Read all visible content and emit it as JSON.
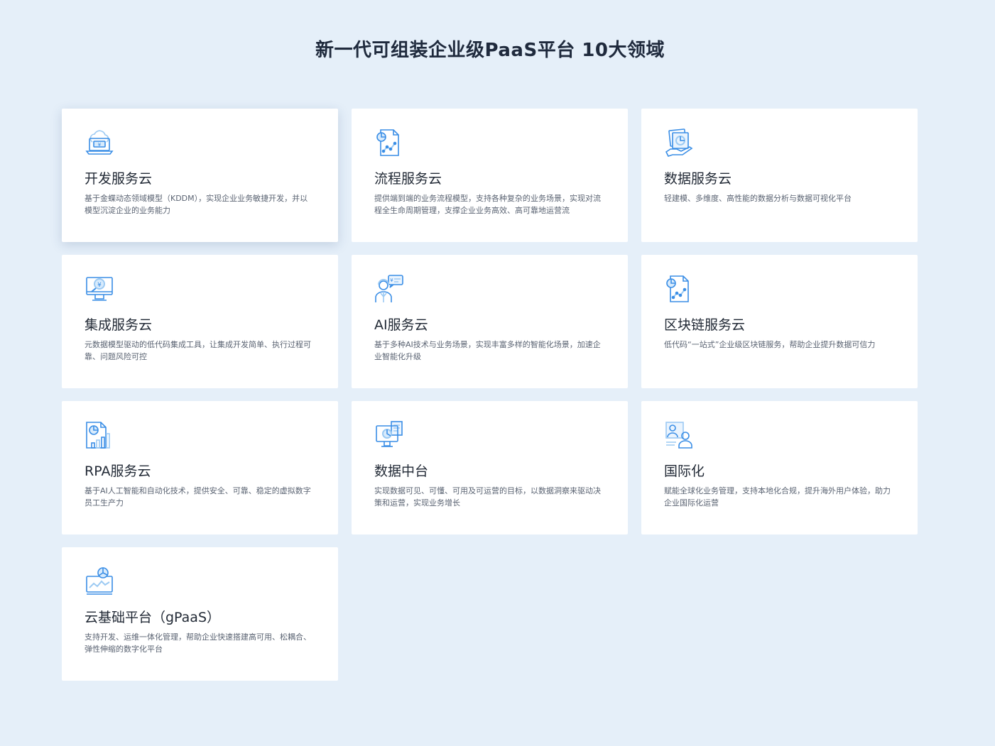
{
  "page": {
    "title": "新一代可组装企业级PaaS平台 10大领域"
  },
  "cards": [
    {
      "icon": "cloud-laptop-icon",
      "title": "开发服务云",
      "desc": "基于金蝶动态领域模型（KDDM），实现企业业务敏捷开发，并以模型沉淀企业的业务能力"
    },
    {
      "icon": "process-document-icon",
      "title": "流程服务云",
      "desc": "提供端到端的业务流程模型，支持各种复杂的业务场景，实现对流程全生命周期管理，支撑企业业务高效、高可靠地运营流"
    },
    {
      "icon": "data-hand-icon",
      "title": "数据服务云",
      "desc": "轻建模、多维度、高性能的数据分析与数据可视化平台"
    },
    {
      "icon": "monitor-yen-icon",
      "title": "集成服务云",
      "desc": "元数据模型驱动的低代码集成工具，让集成开发简单、执行过程可靠、问题风险可控"
    },
    {
      "icon": "ai-person-icon",
      "title": "AI服务云",
      "desc": "基于多种AI技术与业务场景，实现丰富多样的智能化场景，加速企业智能化升级"
    },
    {
      "icon": "chain-document-icon",
      "title": "区块链服务云",
      "desc": "低代码“一站式”企业级区块链服务，帮助企业提升数据可信力"
    },
    {
      "icon": "bar-chart-document-icon",
      "title": "RPA服务云",
      "desc": "基于AI人工智能和自动化技术，提供安全、可靠、稳定的虚拟数字员工生产力"
    },
    {
      "icon": "dashboard-monitor-icon",
      "title": "数据中台",
      "desc": "实现数据可见、可懂、可用及可运营的目标，以数据洞察来驱动决策和运营，实现业务增长"
    },
    {
      "icon": "global-users-icon",
      "title": "国际化",
      "desc": "赋能全球化业务管理，支持本地化合规，提升海外用户体验，助力企业国际化运营"
    },
    {
      "icon": "infrastructure-chart-icon",
      "title": "云基础平台（gPaaS）",
      "desc": "支持开发、运维一体化管理，帮助企业快速搭建高可用、松耦合、弹性伸缩的数字化平台"
    }
  ],
  "colors": {
    "background": "#e5eff9",
    "card": "#ffffff",
    "icon_primary": "#3a8ee6",
    "icon_secondary": "#9ccaf3"
  }
}
